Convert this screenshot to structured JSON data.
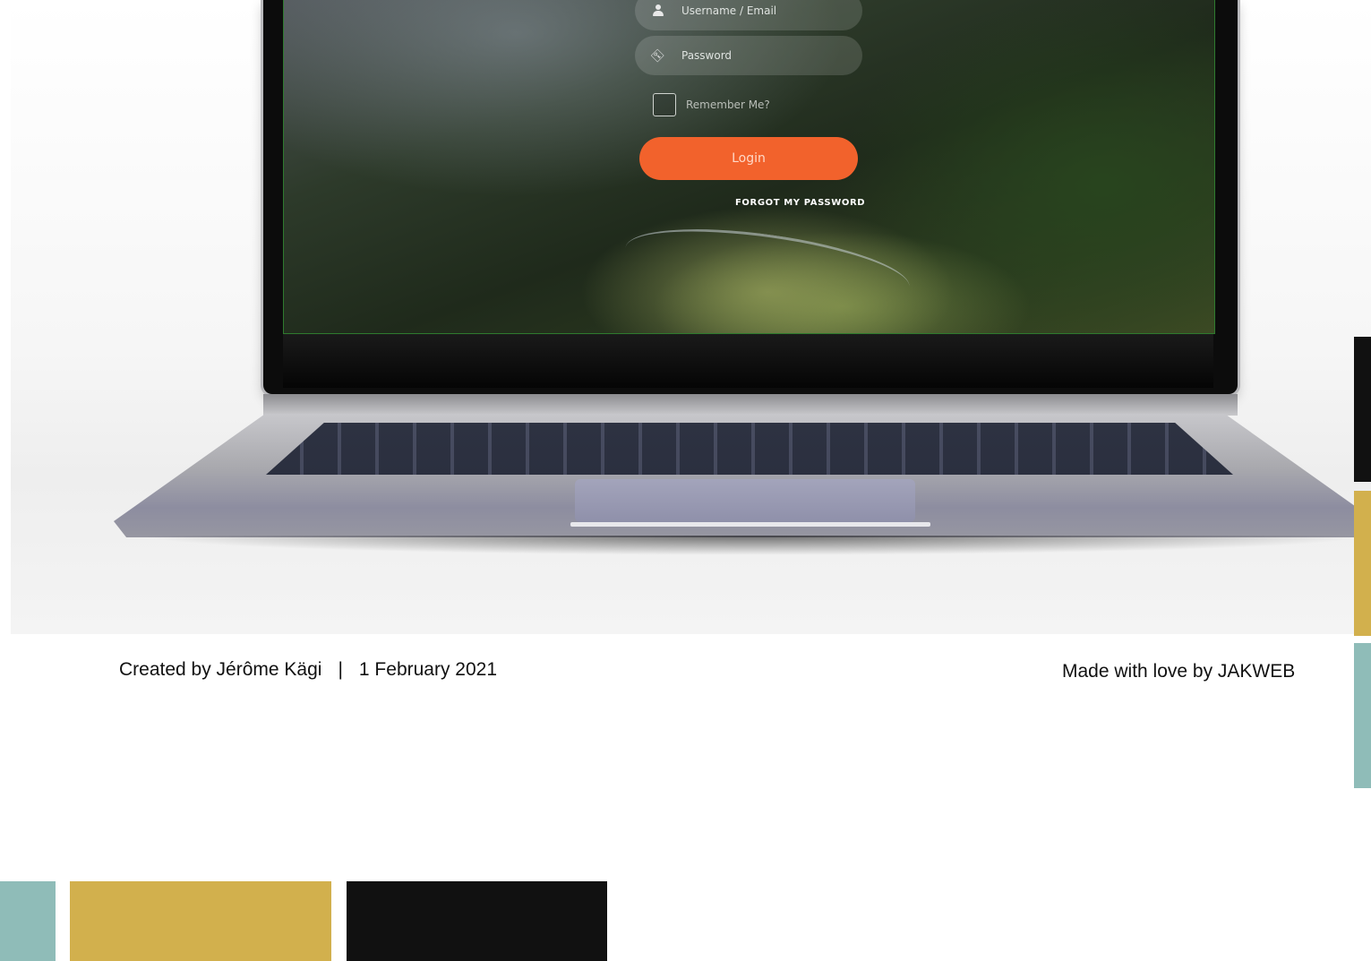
{
  "login": {
    "username_placeholder": "Username / Email",
    "password_placeholder": "Password",
    "remember_label": "Remember Me?",
    "login_button": "Login",
    "forgot_link": "FORGOT MY PASSWORD",
    "user_icon": "user-icon",
    "key_icon": "key-icon"
  },
  "footer": {
    "creator": "Created by Jérôme Kägi",
    "separator": "|",
    "date": "1 February 2021",
    "made_with": "Made with love by JAKWEB"
  },
  "palette": {
    "teal": "#8fbcb8",
    "gold": "#d2b04d",
    "black": "#111111",
    "accent_orange": "#f2622c"
  }
}
